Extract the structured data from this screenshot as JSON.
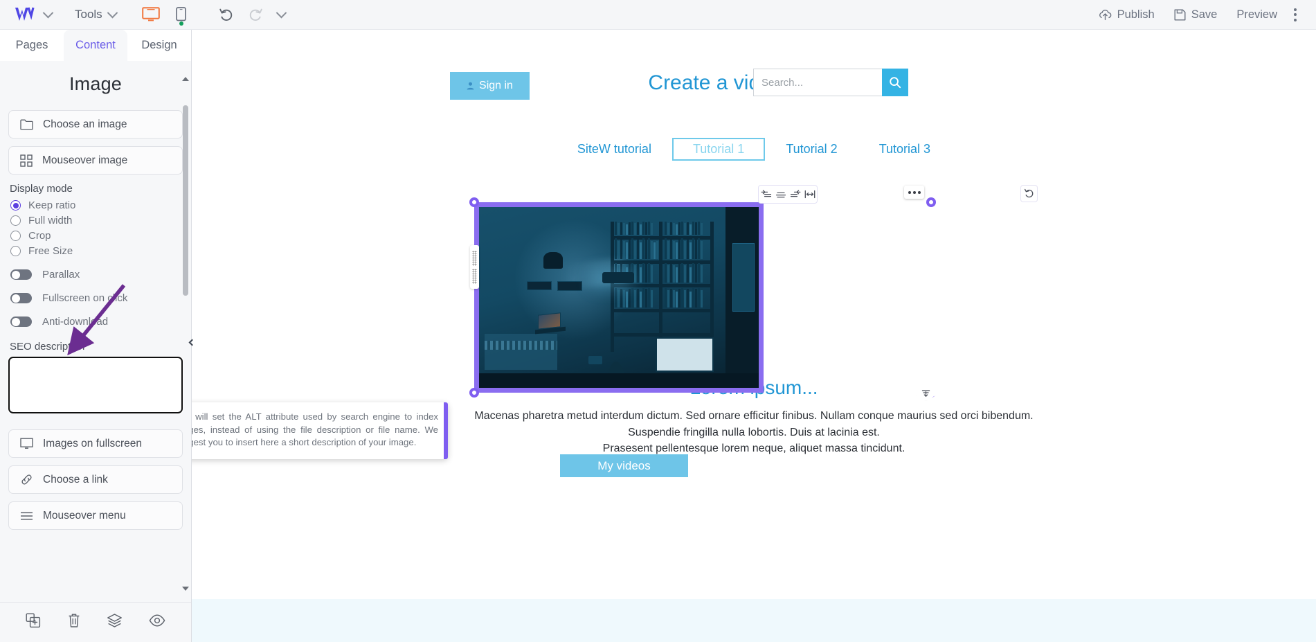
{
  "topbar": {
    "logo": "w-logo",
    "tools_label": "Tools",
    "desktop_icon": "desktop-icon",
    "mobile_icon": "mobile-icon",
    "undo_icon": "undo-icon",
    "redo_icon": "redo-icon",
    "publish_label": "Publish",
    "save_label": "Save",
    "preview_label": "Preview",
    "kebab_icon": "kebab-menu-icon"
  },
  "left_panel": {
    "tabs": [
      {
        "label": "Pages",
        "active": false
      },
      {
        "label": "Content",
        "active": true
      },
      {
        "label": "Design",
        "active": false
      }
    ],
    "title": "Image",
    "choose_image_label": "Choose an image",
    "mouseover_image_label": "Mouseover image",
    "display_mode_label": "Display mode",
    "display_modes": [
      {
        "label": "Keep ratio",
        "selected": true
      },
      {
        "label": "Full width",
        "selected": false
      },
      {
        "label": "Crop",
        "selected": false
      },
      {
        "label": "Free Size",
        "selected": false
      }
    ],
    "toggles": [
      {
        "label": "Parallax",
        "on": false
      },
      {
        "label": "Fullscreen on click",
        "on": false
      },
      {
        "label": "Anti-download",
        "on": false
      }
    ],
    "seo_label": "SEO description",
    "seo_value": "",
    "seo_placeholder": "",
    "images_fullscreen_label": "Images on fullscreen",
    "choose_link_label": "Choose a link",
    "mouseover_menu_label": "Mouseover menu",
    "footer_icons": [
      "duplicate-icon",
      "trash-icon",
      "layers-icon",
      "eye-icon"
    ]
  },
  "tooltip": {
    "text": "This will set the ALT attribute used by search engine to index images, instead of using the file description or file name. We suggest you to insert here a short description of your image."
  },
  "canvas": {
    "signin_label": "Sign in",
    "site_title": "Create a video website",
    "search": {
      "placeholder": "Search...",
      "value": "",
      "button_icon": "search-icon"
    },
    "nav": [
      {
        "label": "SiteW tutorial",
        "selected": false
      },
      {
        "label": "Tutorial 1",
        "selected": true
      },
      {
        "label": "Tutorial 2",
        "selected": false
      },
      {
        "label": "Tutorial 3",
        "selected": false
      }
    ],
    "align_toolbar": [
      "align-left-icon",
      "align-center-icon",
      "align-right-icon",
      "align-stretch-icon"
    ],
    "rotate_icon": "rotate-reset-icon",
    "image_options_icon": "more-options-icon",
    "image_alt": "dark-blue-room-with-bookshelves-and-projector",
    "lorem_title": "Lorem ipsum...",
    "lorem_line1": "Macenas pharetra metud interdum dictum. Sed ornare efficitur finibus. Nullam conque maurius sed orci bibendum.",
    "lorem_line2": "Suspendie fringilla nulla lobortis. Duis at lacinia est.",
    "lorem_line3": "Prasesent pellentesque lorem neque, aliquet massa tincidunt.",
    "cta_label": "My videos"
  },
  "colors": {
    "accent_purple": "#6a5ce8",
    "selection_purple": "#8a6df0",
    "site_blue": "#2196d4",
    "button_blue": "#6ec5e8",
    "panel_bg": "#f6f7f9",
    "topbar_bg": "#f5f6f8"
  }
}
